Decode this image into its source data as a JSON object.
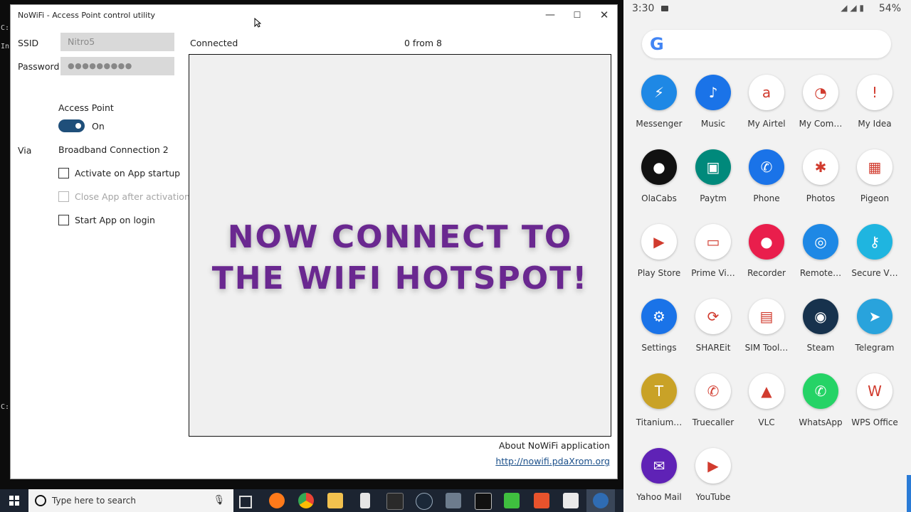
{
  "console": {
    "lines": [
      "C:",
      "In",
      "C:"
    ]
  },
  "window": {
    "title": "NoWiFi - Access Point control utility",
    "min_glyph": "—",
    "max_glyph": "☐",
    "close_glyph": "✕"
  },
  "form": {
    "ssid_label": "SSID",
    "ssid_value": "Nitro5",
    "password_label": "Password",
    "password_value": "●●●●●●●●●",
    "access_point_label": "Access Point",
    "toggle_state": "On",
    "via_label": "Via",
    "via_value": "Broadband Connection 2",
    "checkboxes": [
      "Activate on App startup",
      "Close App after activation",
      "Start App on login"
    ]
  },
  "status": {
    "connection": "Connected",
    "clients": "0 from 8"
  },
  "overlay": {
    "line1": "NOW CONNECT TO",
    "line2": "THE WIFI HOTSPOT!"
  },
  "footer": {
    "about": "About NoWiFi application",
    "link": "http://nowifi.pdaXrom.org"
  },
  "taskbar": {
    "search_placeholder": "Type here to search",
    "icons": [
      "task-view",
      "firefox",
      "chrome",
      "file-explorer",
      "calculator",
      "notion",
      "steam",
      "network",
      "terminal",
      "camtasia",
      "camtasia-recorder",
      "store",
      "nowifi"
    ]
  },
  "phone": {
    "time": "3:30",
    "battery": "54%",
    "signal": "◢ ◢ ▮",
    "google_glyph": "G",
    "apps": [
      {
        "name": "Messenger",
        "color": "#1e88e5",
        "glyph": "⚡"
      },
      {
        "name": "Music",
        "color": "#1a73e8",
        "glyph": "♪"
      },
      {
        "name": "My Airtel",
        "color": "#ffffff",
        "glyph": "a"
      },
      {
        "name": "My Com…",
        "color": "#ffffff",
        "glyph": "◔"
      },
      {
        "name": "My Idea",
        "color": "#ffffff",
        "glyph": "!"
      },
      {
        "name": "OlaCabs",
        "color": "#111111",
        "glyph": "●"
      },
      {
        "name": "Paytm",
        "color": "#00897b",
        "glyph": "▣"
      },
      {
        "name": "Phone",
        "color": "#1a73e8",
        "glyph": "✆"
      },
      {
        "name": "Photos",
        "color": "#ffffff",
        "glyph": "✱"
      },
      {
        "name": "Pigeon",
        "color": "#ffffff",
        "glyph": "▦"
      },
      {
        "name": "Play Store",
        "color": "#ffffff",
        "glyph": "▶"
      },
      {
        "name": "Prime Vi…",
        "color": "#ffffff",
        "glyph": "▭"
      },
      {
        "name": "Recorder",
        "color": "#e91e4c",
        "glyph": "●"
      },
      {
        "name": "Remote…",
        "color": "#1e88e5",
        "glyph": "◎"
      },
      {
        "name": "Secure V…",
        "color": "#1fb5e0",
        "glyph": "⚷"
      },
      {
        "name": "Settings",
        "color": "#1a73e8",
        "glyph": "⚙"
      },
      {
        "name": "SHAREit",
        "color": "#ffffff",
        "glyph": "⟳"
      },
      {
        "name": "SIM Tool…",
        "color": "#ffffff",
        "glyph": "▤"
      },
      {
        "name": "Steam",
        "color": "#17324d",
        "glyph": "◉"
      },
      {
        "name": "Telegram",
        "color": "#29a3dc",
        "glyph": "➤"
      },
      {
        "name": "Titanium…",
        "color": "#c9a227",
        "glyph": "T"
      },
      {
        "name": "Truecaller",
        "color": "#ffffff",
        "glyph": "✆"
      },
      {
        "name": "VLC",
        "color": "#ffffff",
        "glyph": "▲"
      },
      {
        "name": "WhatsApp",
        "color": "#25d366",
        "glyph": "✆"
      },
      {
        "name": "WPS Office",
        "color": "#ffffff",
        "glyph": "W"
      },
      {
        "name": "Yahoo Mail",
        "color": "#5f22b6",
        "glyph": "✉"
      },
      {
        "name": "YouTube",
        "color": "#ffffff",
        "glyph": "▶"
      }
    ]
  }
}
